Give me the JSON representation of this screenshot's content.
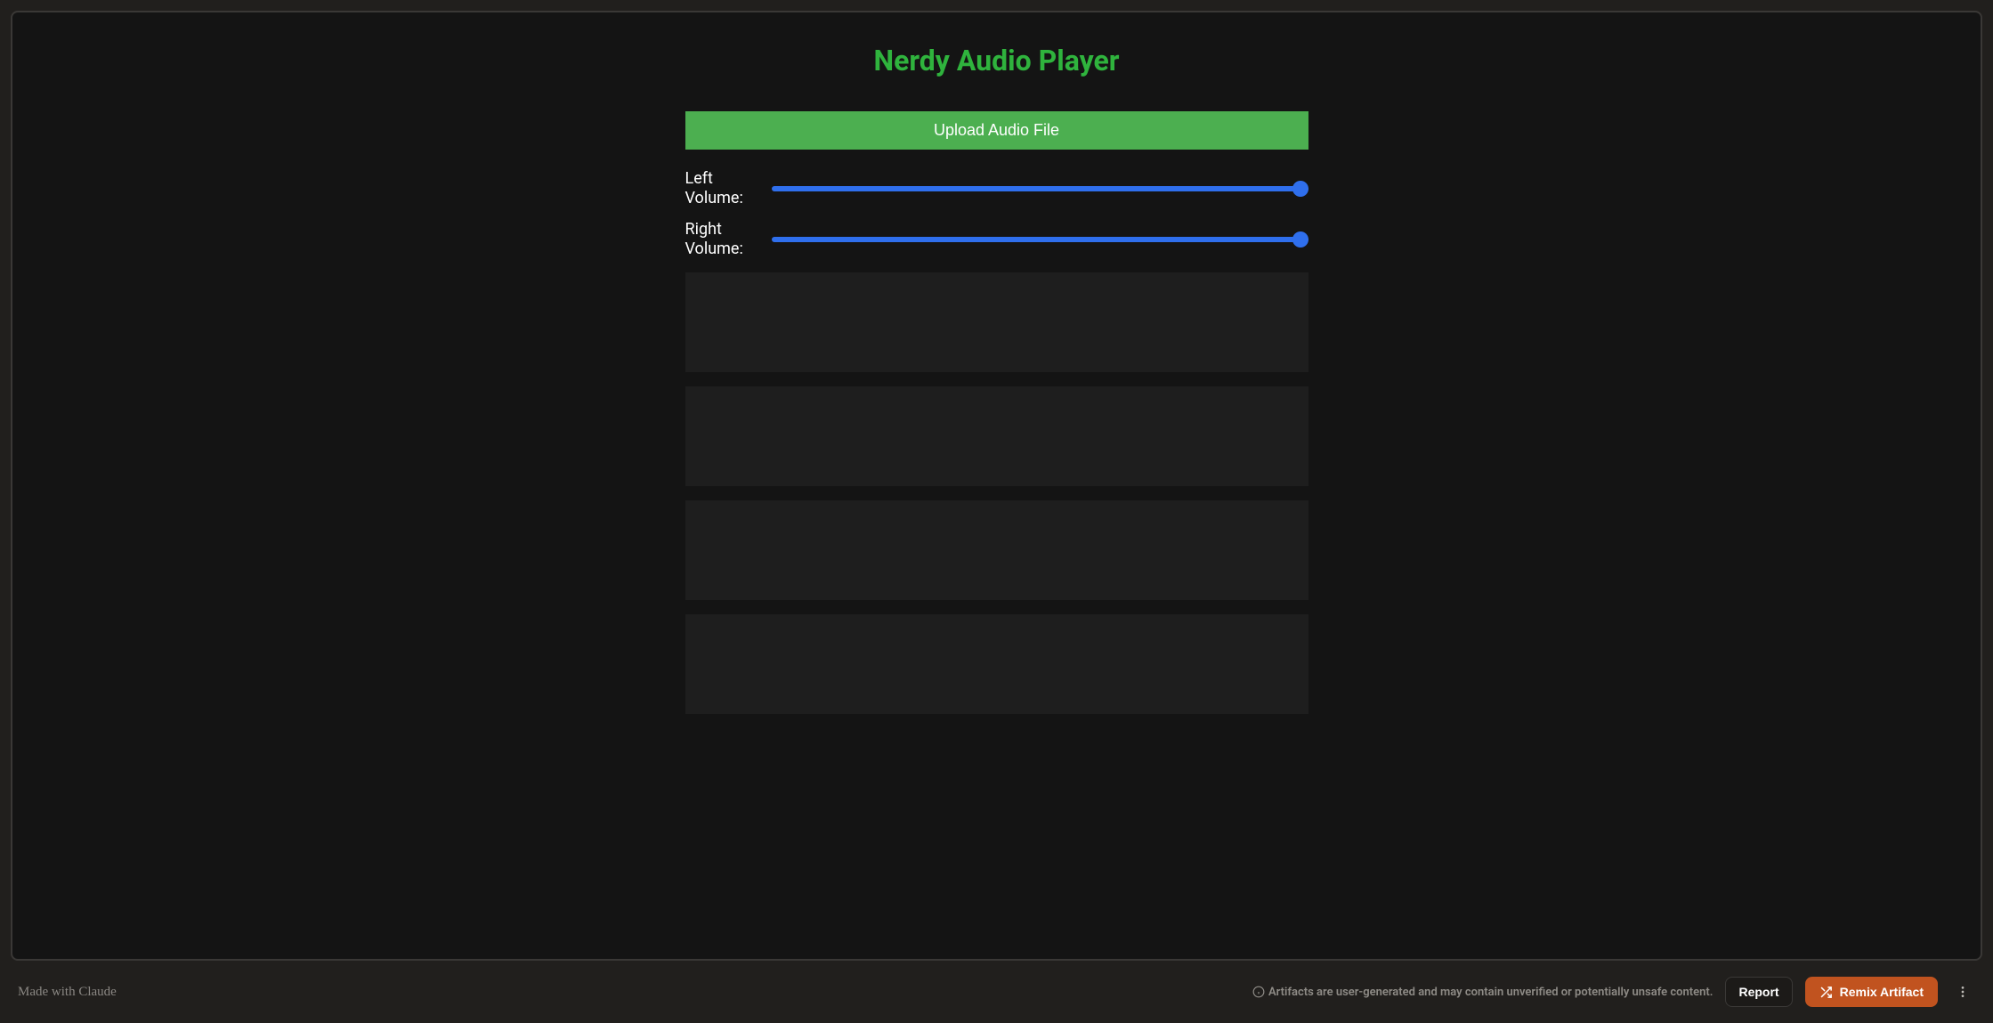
{
  "header": {
    "title": "Nerdy Audio Player"
  },
  "upload": {
    "label": "Upload Audio File"
  },
  "sliders": {
    "left": {
      "label": "Left Volume:",
      "value": 100,
      "min": 0,
      "max": 100
    },
    "right": {
      "label": "Right Volume:",
      "value": 100,
      "min": 0,
      "max": 100
    }
  },
  "footer": {
    "made_with": "Made with ",
    "brand": "Claude",
    "disclaimer": "Artifacts are user-generated and may contain unverified or potentially unsafe content.",
    "report_label": "Report",
    "remix_label": "Remix Artifact"
  },
  "colors": {
    "accent_green": "#2fb33d",
    "button_green": "#4caf50",
    "slider_blue": "#2f6fed",
    "remix_orange": "#c1531f",
    "bg_dark": "#141414",
    "bg_frame": "#211f1d",
    "panel": "#1e1e1e"
  }
}
